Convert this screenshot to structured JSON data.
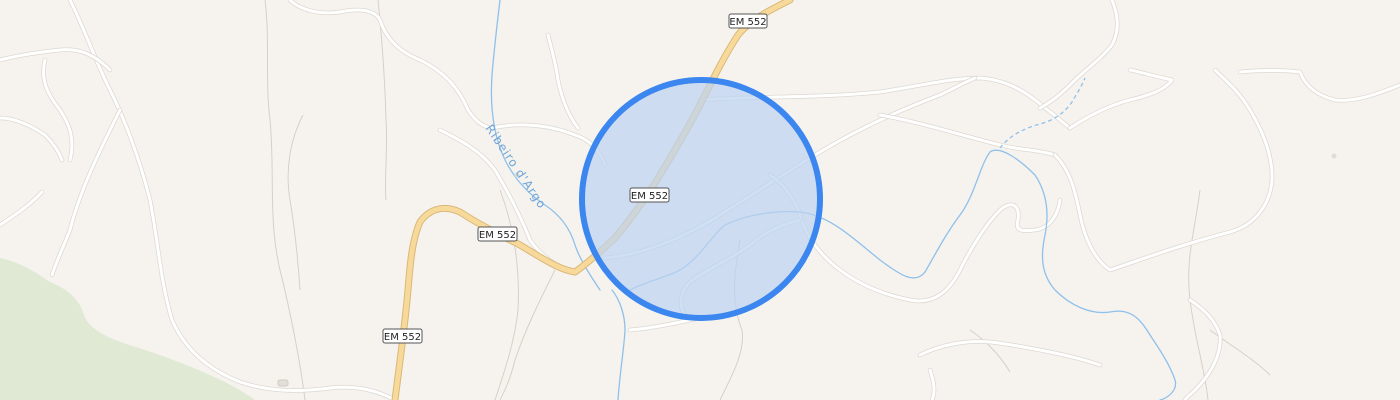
{
  "map": {
    "road_ref": "EM 552",
    "river_name": "Ribeiro d'Argo",
    "road_labels": [
      {
        "id": "road-label-top",
        "text": "EM 552"
      },
      {
        "id": "road-label-center",
        "text": "EM 552"
      },
      {
        "id": "road-label-left",
        "text": "EM 552"
      },
      {
        "id": "road-label-bottom",
        "text": "EM 552"
      }
    ],
    "accuracy_circle": {
      "fill": "#bcd2f0",
      "stroke": "#3b86ef"
    },
    "colors": {
      "background": "#f6f3ef",
      "forest": "#dfe9d3",
      "water": "#8fc0ea",
      "main_road": "#f7d99a",
      "minor_road": "#ffffff"
    }
  }
}
